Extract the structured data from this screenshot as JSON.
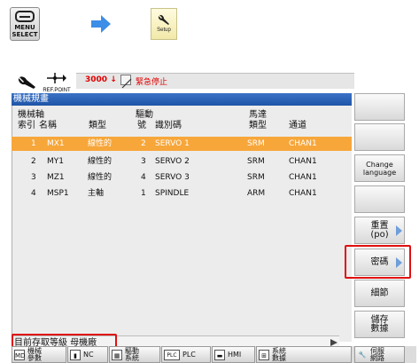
{
  "instruction": {
    "menu_key": "MENU\nSELECT",
    "setup_key": "Setup"
  },
  "header": {
    "refpoint": "REF.POINT",
    "alarm_code": "3000",
    "alarm_text": "緊急停止"
  },
  "panel": {
    "title": "機械規畫",
    "columns": {
      "axis_index_top": "機械軸",
      "axis_index_bottom": "索引",
      "name": "名稱",
      "type": "類型",
      "drive_top": "驅動",
      "drive_bottom": "號",
      "identifier": "識別碼",
      "motor_top": "馬達",
      "motor_bottom": "類型",
      "channel": "通道"
    },
    "rows": [
      {
        "index": "1",
        "name": "MX1",
        "type": "線性的",
        "drive": "2",
        "ident": "SERVO 1",
        "motor": "SRM",
        "channel": "CHAN1"
      },
      {
        "index": "2",
        "name": "MY1",
        "type": "線性的",
        "drive": "3",
        "ident": "SERVO 2",
        "motor": "SRM",
        "channel": "CHAN1"
      },
      {
        "index": "3",
        "name": "MZ1",
        "type": "線性的",
        "drive": "4",
        "ident": "SERVO 3",
        "motor": "SRM",
        "channel": "CHAN1"
      },
      {
        "index": "4",
        "name": "MSP1",
        "type": "主軸",
        "drive": "1",
        "ident": "SPINDLE",
        "motor": "ARM",
        "channel": "CHAN1"
      }
    ],
    "status_line": "目前存取等級 母機廠"
  },
  "softkeys": {
    "change_language": "Change\nlanguage",
    "reset_po": "重置\n(po)",
    "password": "密碼",
    "details": "細節",
    "save_data": "儲存\n數據"
  },
  "bottom_keys": {
    "md": "MD",
    "machine_params": "機械\n參數",
    "nc": "NC",
    "drive_system": "驅動\n系統",
    "plc_icon": "PLC",
    "plc": "PLC",
    "hmi": "HMI",
    "system_data": "系統\n數據",
    "service_network": "伺服\n網路"
  }
}
